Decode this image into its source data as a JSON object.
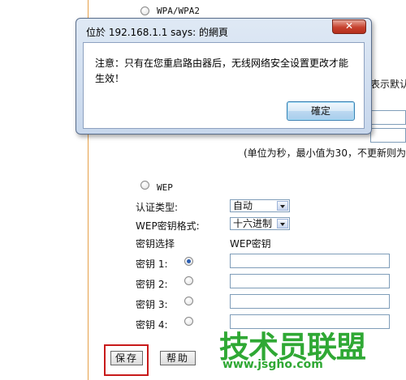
{
  "background_page": {
    "wpa_wpa2_label": "WPA/WPA2",
    "right_edge_text": "表示默认",
    "interval_note": "(单位为秒，最小值为30，不更新则为",
    "wep_label": "WEP",
    "auth_type_label": "认证类型:",
    "auth_type_value": "自动",
    "key_format_label": "WEP密钥格式:",
    "key_format_value": "十六进制",
    "key_select_label": "密钥选择",
    "wep_key_header": "WEP密钥",
    "keys": [
      {
        "label": "密钥 1:",
        "checked": true,
        "value": ""
      },
      {
        "label": "密钥 2:",
        "checked": false,
        "value": ""
      },
      {
        "label": "密钥 3:",
        "checked": false,
        "value": ""
      },
      {
        "label": "密钥 4:",
        "checked": false,
        "value": ""
      }
    ],
    "save_button": "保存",
    "help_button": "帮助",
    "accent_color": "#e6a14a",
    "highlight_color": "#c81a1a"
  },
  "dialog": {
    "title": "位於 192.168.1.1 says: 的網頁",
    "close_label": "✕",
    "message": "注意：只有在您重启路由器后，无线网络安全设置更改才能生效！",
    "ok_label": "確定"
  },
  "watermark": {
    "main": "技术员联盟",
    "url": "www.jsgho.com",
    "color": "#2fa834"
  }
}
